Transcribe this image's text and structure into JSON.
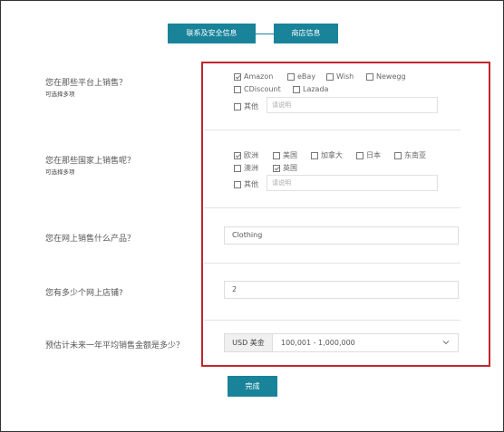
{
  "steps": {
    "step1": "联系及安全信息",
    "step2": "商店信息"
  },
  "q1": {
    "question": "您在那些平台上销售？",
    "hint": "可选择多项",
    "options": [
      {
        "label": "Amazon",
        "checked": true
      },
      {
        "label": "eBay",
        "checked": false
      },
      {
        "label": "Wish",
        "checked": false
      },
      {
        "label": "Newegg",
        "checked": false
      },
      {
        "label": "CDiscount",
        "checked": false
      },
      {
        "label": "Lazada",
        "checked": false
      }
    ],
    "other_label": "其他",
    "other_placeholder": "请说明"
  },
  "q2": {
    "question": "您在那些国家上销售呢？",
    "hint": "可选择多项",
    "options": [
      {
        "label": "欧洲",
        "checked": true
      },
      {
        "label": "美国",
        "checked": false
      },
      {
        "label": "加拿大",
        "checked": false
      },
      {
        "label": "日本",
        "checked": false
      },
      {
        "label": "东南亚",
        "checked": false
      },
      {
        "label": "澳洲",
        "checked": false
      },
      {
        "label": "英国",
        "checked": true
      }
    ],
    "other_label": "其他",
    "other_placeholder": "请说明"
  },
  "q3": {
    "question": "您在网上销售什么产品？",
    "value": "Clothing"
  },
  "q4": {
    "question": "您有多少个网上店铺?",
    "value": "2"
  },
  "q5": {
    "question": "预估计未来一年平均销售金额是多少？",
    "currency": "USD 美金",
    "value": "100,001 - 1,000,000"
  },
  "done_label": "完成",
  "colors": {
    "accent": "#19839a",
    "highlight": "#c0262c"
  }
}
